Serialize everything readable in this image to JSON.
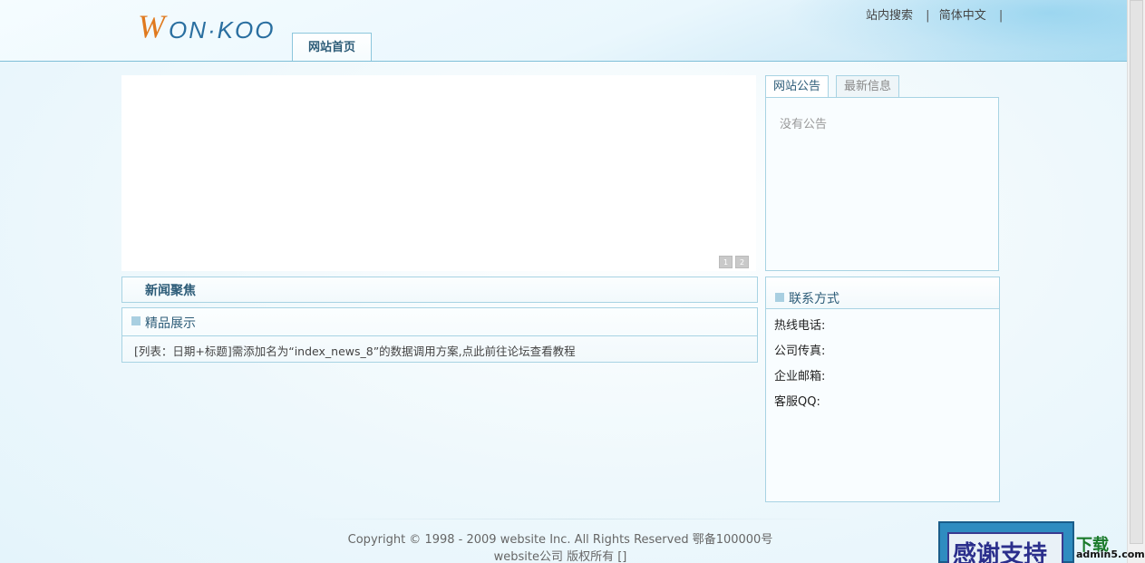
{
  "header": {
    "logo": "WONKOO",
    "top_links": [
      "站内搜索",
      "简体中文"
    ],
    "nav_tabs": [
      {
        "label": "网站首页"
      }
    ]
  },
  "banner": {
    "pager": [
      "1",
      "2"
    ]
  },
  "notice": {
    "tabs": [
      "网站公告",
      "最新信息"
    ],
    "empty_text": "没有公告"
  },
  "news_focus": {
    "title": "新闻聚焦"
  },
  "products": {
    "title": "精品展示",
    "note": "[列表：日期+标题]需添加名为“index_news_8”的数据调用方案,点此前往论坛查看教程"
  },
  "contact": {
    "title": "联系方式",
    "rows": [
      "热线电话:",
      "公司传真:",
      "企业邮箱:",
      "客服QQ:"
    ]
  },
  "footer": {
    "line1": "Copyright © 1998 - 2009 website Inc. All Rights Reserved 鄂备100000号",
    "line2": "website公司  版权所有  []"
  },
  "watermark": {
    "text": "感谢支持",
    "download": "下载",
    "site": "admin5.com"
  }
}
